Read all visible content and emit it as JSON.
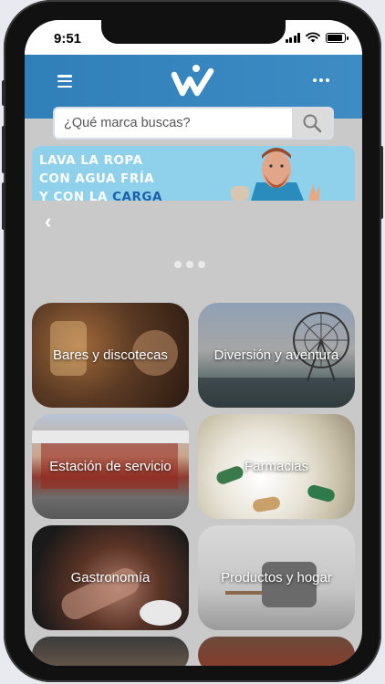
{
  "status_bar": {
    "time": "9:51"
  },
  "app_bar": {
    "logo_name": "w-logo"
  },
  "search": {
    "placeholder": "¿Qué marca buscas?"
  },
  "banner": {
    "line1": "LAVA LA ROPA",
    "line2_prefix": "CON AGUA ",
    "line2_accent": "FRÍA",
    "line3_prefix": "Y CON LA ",
    "line3_accent": "CARGA"
  },
  "carousel": {
    "dot_count": 3
  },
  "categories": [
    {
      "label": "Bares y discotecas"
    },
    {
      "label": "Diversión y aventura"
    },
    {
      "label": "Estación de servicio"
    },
    {
      "label": "Farmacias"
    },
    {
      "label": "Gastronomía"
    },
    {
      "label": "Productos y hogar"
    }
  ]
}
